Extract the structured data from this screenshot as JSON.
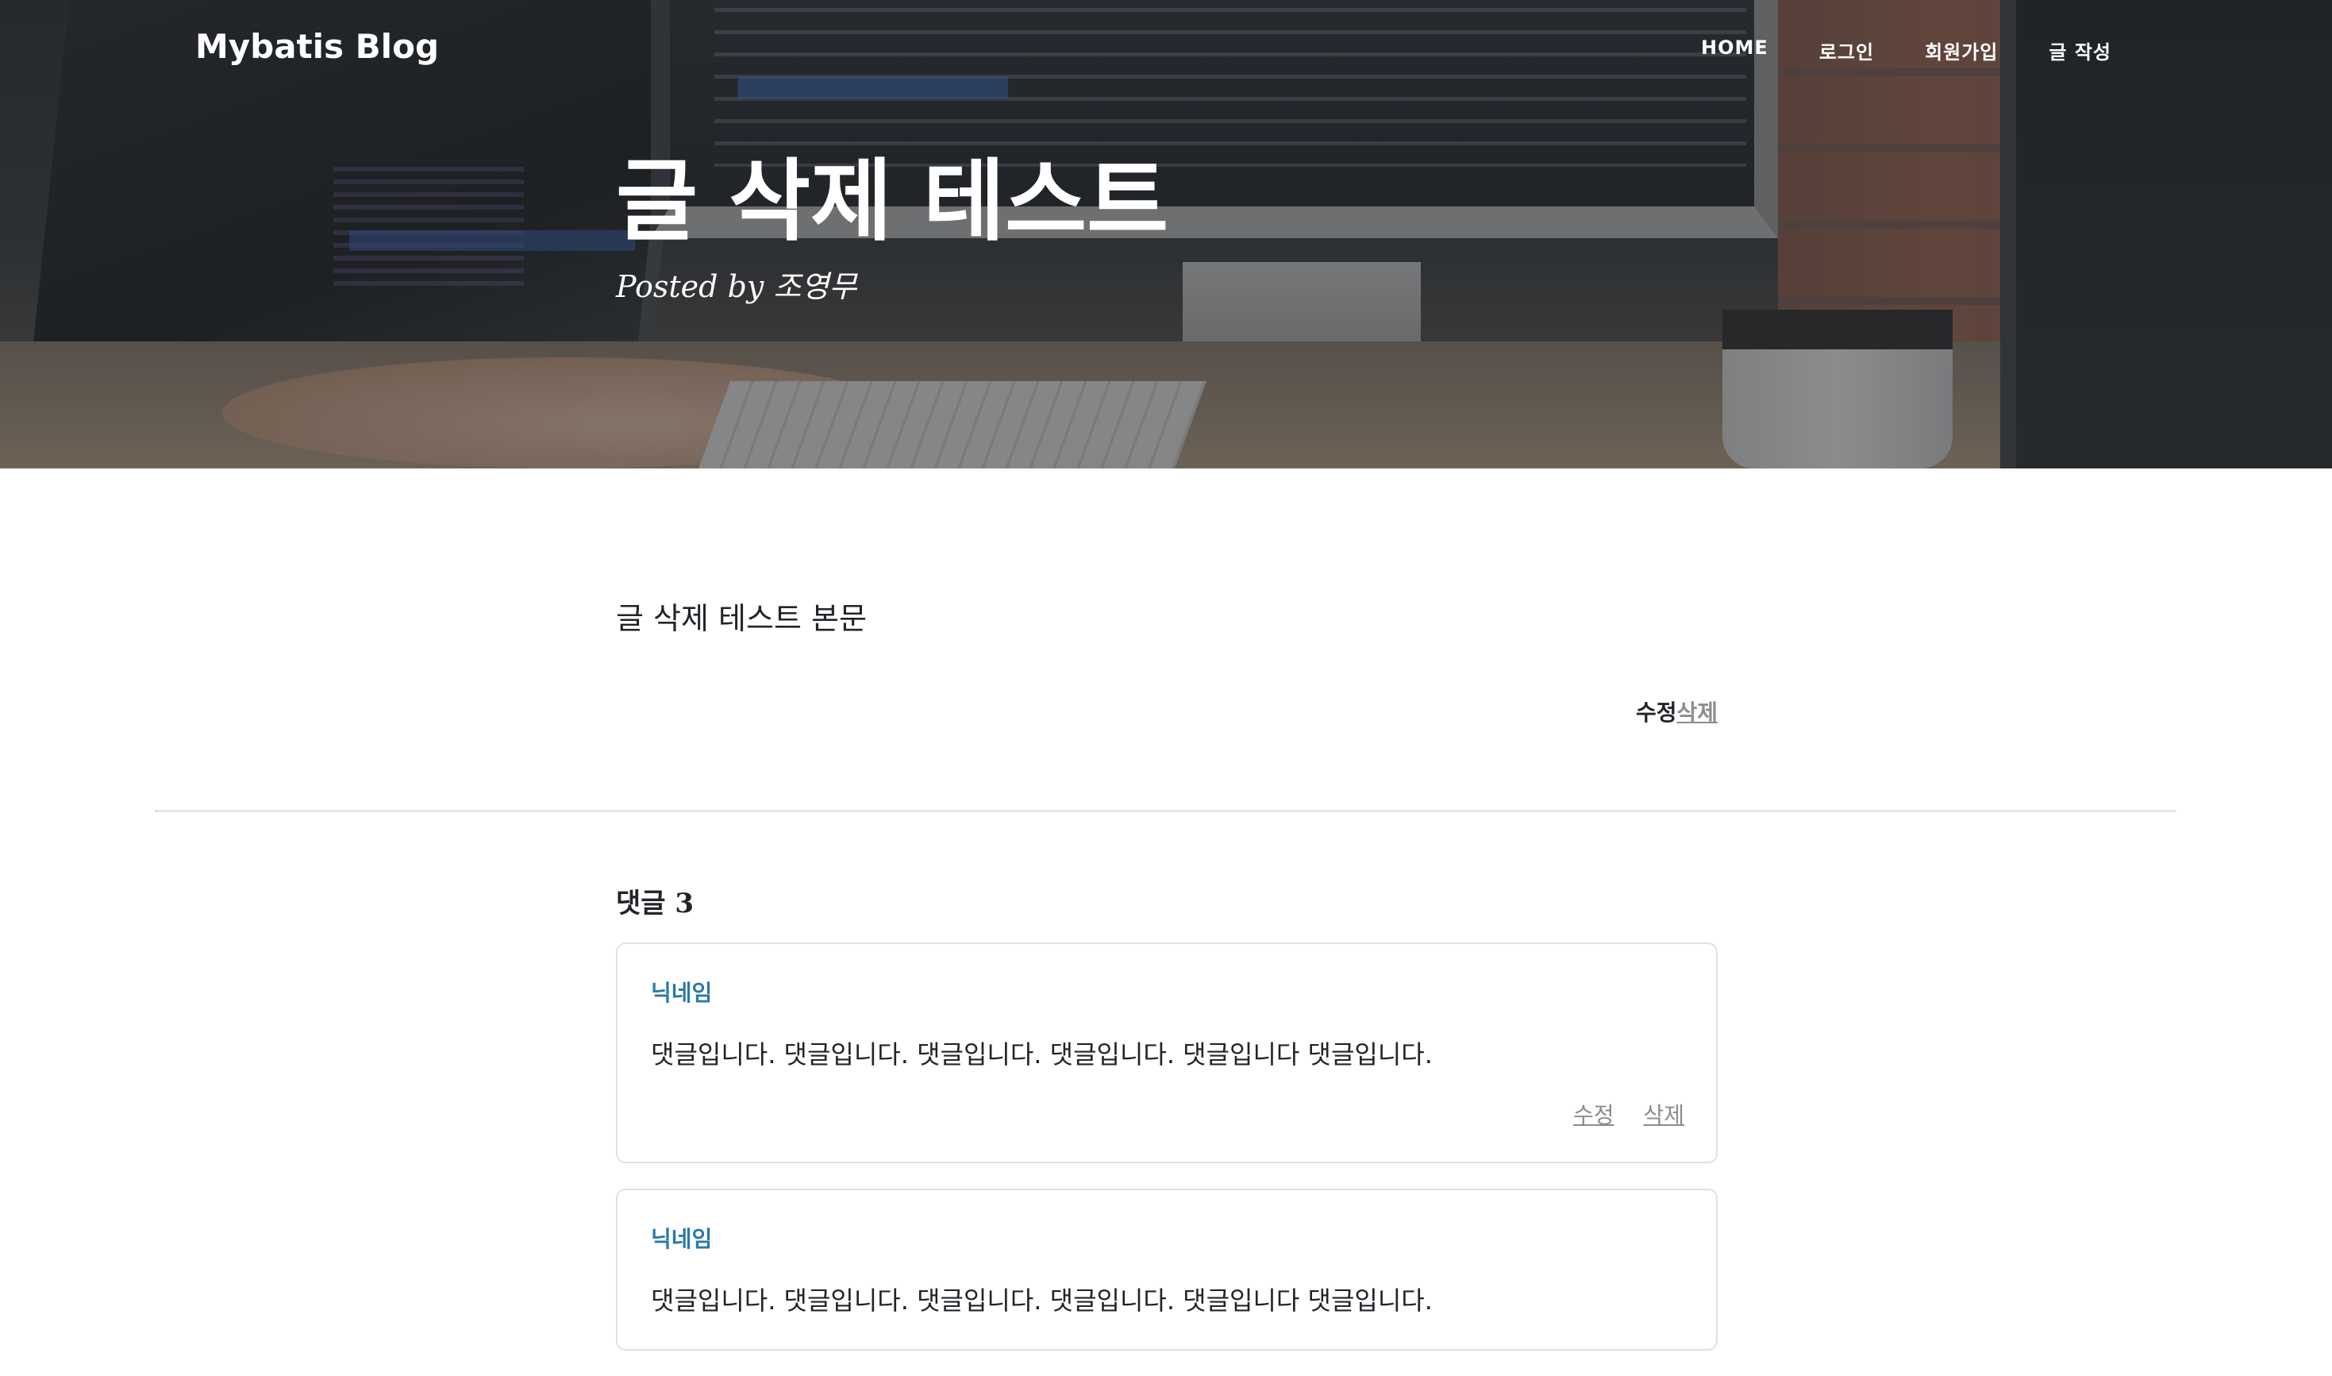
{
  "navbar": {
    "brand": "Mybatis Blog",
    "items": [
      {
        "label": "HOME"
      },
      {
        "label": "로그인"
      },
      {
        "label": "회원가입"
      },
      {
        "label": "글 작성"
      }
    ]
  },
  "post": {
    "title": "글 삭제 테스트",
    "meta": "Posted by 조영무",
    "body": "글 삭제 테스트 본문",
    "edit_label": "수정",
    "delete_label": "삭제"
  },
  "comments": {
    "title": "댓글 3",
    "items": [
      {
        "author": "닉네임",
        "text": "댓글입니다. 댓글입니다. 댓글입니다. 댓글입니다. 댓글입니다 댓글입니다.",
        "edit_label": "수정",
        "delete_label": "삭제"
      },
      {
        "author": "닉네임",
        "text": "댓글입니다. 댓글입니다. 댓글입니다. 댓글입니다. 댓글입니다 댓글입니다."
      }
    ]
  },
  "colors": {
    "link_accent": "#2a7aa8",
    "muted_link": "#8c8c8c",
    "overlay": "rgba(33,37,41,0.5)"
  }
}
